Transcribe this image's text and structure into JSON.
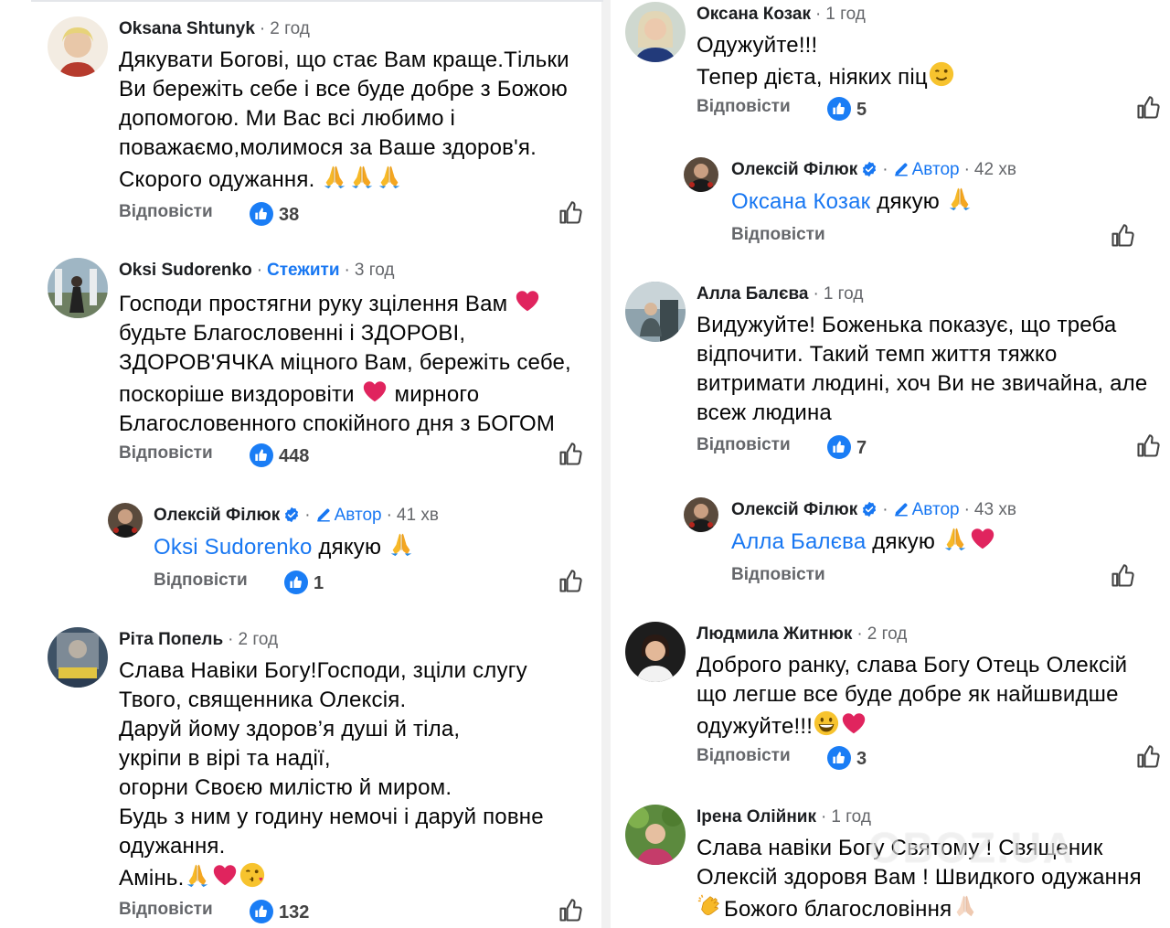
{
  "labels": {
    "reply": "Відповісти",
    "author": "Автор",
    "follow": "Стежити"
  },
  "watermark": "OBOZ.UA",
  "colors": {
    "link": "#1877f2",
    "meta": "#65676b",
    "like_badge": "#1a7df5",
    "heart": "#e0245e"
  },
  "left": [
    {
      "name": "Oksana Shtunyk",
      "time": "2 год",
      "text": "Дякувати Богові, що стає Вам краще.Тільки\nВи бережіть себе і все буде добре з Божою\nдопомогою. Ми Вас всі любимо і\nповажаємо,молимося за Ваше здоров'я.\nСкорого одужання. ",
      "emoji": "pray-pray-pray",
      "likes": "38"
    },
    {
      "name": "Oksi Sudorenko",
      "time": "3 год",
      "line1": "Господи простягни руку зцілення Вам ",
      "line2": "будьте Благословенні і ЗДОРОВІ,\nЗДОРОВ'ЯЧКА міцного Вам, бережіть себе,",
      "line3a": "поскоріше виздоровіти ",
      "line3b": " мирного",
      "line4": "Благословенного спокійного дня з БОГОМ",
      "likes": "448"
    },
    {
      "name": "Олексій Філюк",
      "time": "41 хв",
      "mention": "Oksi Sudorenko",
      "text": " дякую ",
      "likes": "1"
    },
    {
      "name": "Ріта Попель",
      "time": "2 год",
      "text": "Слава Навіки Богу!Господи, зціли слугу\nТвого, священника Олексія.\nДаруй йому здоров’я душі й тіла,\nукріпи в вірі та надії,\nогорни Своєю милістю й миром.\nБудь з ним у годину немочі і даруй повне\nодужання.",
      "last": "Амінь.",
      "likes": "132"
    }
  ],
  "right": [
    {
      "name": "Оксана Козак",
      "time": "1 год",
      "line1": "Одужуйте!!!",
      "line2": "Тепер дієта, ніяких піц",
      "likes": "5"
    },
    {
      "name": "Олексій Філюк",
      "time": "42 хв",
      "mention": "Оксана Козак",
      "text": " дякую "
    },
    {
      "name": "Алла Балєва",
      "time": "1 год",
      "text": "Видужуйте! Боженька показує, що треба\nвідпочити. Такий темп життя тяжко\nвитримати людині, хоч Ви не звичайна, але\nвсеж людина",
      "likes": "7"
    },
    {
      "name": "Олексій Філюк",
      "time": "43 хв",
      "mention": "Алла Балєва",
      "text": " дякую "
    },
    {
      "name": "Людмила Житнюк",
      "time": "2 год",
      "text": "Доброго ранку, слава Богу Отець Олексій\nщо легше все буде добре як найшвидше",
      "line3": "одужуйте!!!",
      "likes": "3"
    },
    {
      "name": "Ірена Олійник",
      "time": "1 год",
      "text": "Слава навіки Богу Святому ! Священик\nОлексій здоровя Вам ! Швидкого одужання",
      "line3": "Божого благословіння"
    }
  ]
}
